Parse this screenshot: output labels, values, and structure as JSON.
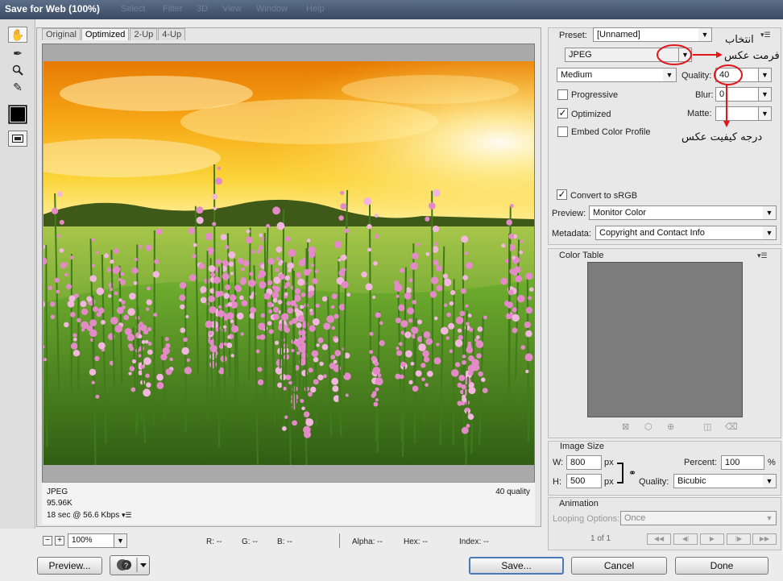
{
  "window": {
    "title": "Save for Web (100%)",
    "ghost_menu": [
      "Select",
      "Filter",
      "3D",
      "View",
      "Window",
      "Help"
    ]
  },
  "tools": [
    {
      "name": "hand-tool-icon",
      "glyph": "✋"
    },
    {
      "name": "slice-select-tool-icon",
      "glyph": "✒"
    },
    {
      "name": "zoom-tool-icon",
      "glyph": "🔍︎"
    },
    {
      "name": "eyedropper-tool-icon",
      "glyph": "✎"
    }
  ],
  "tabs": [
    "Original",
    "Optimized",
    "2-Up",
    "4-Up"
  ],
  "active_tab": "Optimized",
  "info": {
    "format": "JPEG",
    "size": "95.96K",
    "download": "18 sec @ 56.6 Kbps",
    "quality": "40 quality"
  },
  "status": {
    "zoom": "100%",
    "r": "R: --",
    "g": "G: --",
    "b": "B: --",
    "alpha": "Alpha: --",
    "hex": "Hex: --",
    "index": "Index: --"
  },
  "buttons": {
    "preview": "Preview...",
    "save": "Save...",
    "cancel": "Cancel",
    "done": "Done"
  },
  "settings": {
    "preset_label": "Preset:",
    "preset_value": "[Unnamed]",
    "format_value": "JPEG",
    "compression_value": "Medium",
    "quality_label": "Quality:",
    "quality_value": "40",
    "blur_label": "Blur:",
    "blur_value": "0",
    "matte_label": "Matte:",
    "progressive_label": "Progressive",
    "optimized_label": "Optimized",
    "embed_label": "Embed Color Profile",
    "convert_label": "Convert to sRGB",
    "preview_label": "Preview:",
    "preview_value": "Monitor Color",
    "metadata_label": "Metadata:",
    "metadata_value": "Copyright and Contact Info"
  },
  "checkboxes": {
    "progressive": false,
    "optimized": true,
    "embed": false,
    "convert": true
  },
  "color_table": {
    "title": "Color Table"
  },
  "image_size": {
    "title": "Image Size",
    "w_label": "W:",
    "w_value": "800",
    "h_label": "H:",
    "h_value": "500",
    "unit": "px",
    "percent_label": "Percent:",
    "percent_value": "100",
    "percent_unit": "%",
    "quality_label": "Quality:",
    "quality_value": "Bicubic"
  },
  "animation": {
    "title": "Animation",
    "looping_label": "Looping Options:",
    "looping_value": "Once",
    "frame": "1 of 1"
  },
  "annotations": {
    "format_line1": "انتخاب",
    "format_line2": "فرمت عکس",
    "quality_text": "درجه کیفیت عکس"
  },
  "colors": {
    "annotation_red": "#e0161b",
    "accent_blue": "#4b78b8"
  }
}
